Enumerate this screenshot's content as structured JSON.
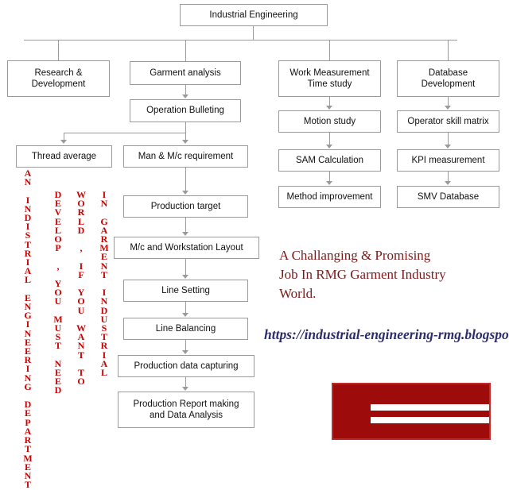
{
  "diagram": {
    "title": "Industrial Engineering",
    "nodes": [
      {
        "id": "root",
        "text": "Industrial Engineering"
      },
      {
        "id": "research",
        "line1": "Research &",
        "line2": "Development"
      },
      {
        "id": "garment",
        "text": "Garment analysis"
      },
      {
        "id": "workmeas",
        "line1": "Work Measurement",
        "line2": "Time study"
      },
      {
        "id": "database",
        "line1": "Database",
        "line2": "Development"
      },
      {
        "id": "opbulleting",
        "text": "Operation Bulleting"
      },
      {
        "id": "motion",
        "text": "Motion study"
      },
      {
        "id": "opskill",
        "text": "Operator skill matrix"
      },
      {
        "id": "thread",
        "text": "Thread average"
      },
      {
        "id": "manmc",
        "text": "Man & M/c requirement"
      },
      {
        "id": "sam",
        "text": "SAM Calculation"
      },
      {
        "id": "kpi",
        "text": "KPI measurement"
      },
      {
        "id": "method",
        "text": "Method improvement"
      },
      {
        "id": "smv",
        "text": "SMV Database"
      },
      {
        "id": "prodtarget",
        "text": "Production target"
      },
      {
        "id": "layout",
        "text": "M/c and Workstation Layout"
      },
      {
        "id": "lineset",
        "text": "Line Setting"
      },
      {
        "id": "linebal",
        "text": "Line Balancing"
      },
      {
        "id": "proddata",
        "text": "Production data capturing"
      },
      {
        "id": "prodreport",
        "line1": "Production Report making",
        "line2": "and Data Analysis"
      }
    ]
  },
  "vertical_texts": [
    {
      "id": "col1",
      "text": "AN INDISTRIAL ENGINEERING DEPARTMENT"
    },
    {
      "id": "col2",
      "text": "DEVELOP , YOU MUST NEED"
    },
    {
      "id": "col3",
      "text": "WORLD , IF YOU WANT TO"
    },
    {
      "id": "col4",
      "text": "IN GARMENT INDUSTRIAL"
    }
  ],
  "tagline": {
    "line1": "A Challanging & Promising",
    "line2": "Job In RMG Garment Industry",
    "line3": "World."
  },
  "url": "https://industrial-engineering-rmg.blogspot.com",
  "colors": {
    "red_text": "#cc0000",
    "tagline": "#7b1a1a",
    "url": "#2d2d6b",
    "logo": "#9e0b0b",
    "line": "#9a9a9a"
  }
}
